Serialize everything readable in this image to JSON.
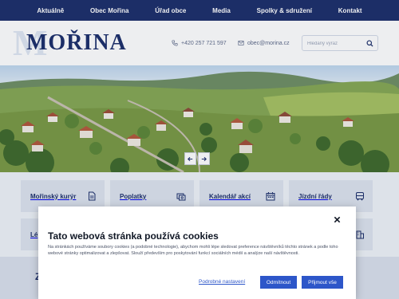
{
  "nav": {
    "items": [
      "Aktuálně",
      "Obec Mořina",
      "Úřad obce",
      "Media",
      "Spolky & sdružení",
      "Kontakt"
    ]
  },
  "header": {
    "watermark": "M",
    "logo": "MOŘINA",
    "phone": "+420 257 721 597",
    "email": "obec@morina.cz",
    "search_placeholder": "Hledaný výraz"
  },
  "tiles": [
    {
      "label": "Mořinský kurýr",
      "icon": "document-icon"
    },
    {
      "label": "Poplatky",
      "icon": "payment-icon"
    },
    {
      "label": "Kalendář akcí",
      "icon": "calendar-icon"
    },
    {
      "label": "Jízdní řády",
      "icon": "bus-icon"
    },
    {
      "label": "Lé",
      "icon": "none"
    },
    {
      "label": "",
      "icon": "building-icon"
    }
  ],
  "lower": {
    "partial_text": "Z"
  },
  "cookie": {
    "title": "Tato webová stránka používá cookies",
    "text": "Na stránkách používáme soubory cookies (a podobné technologie), abychom mohli lépe sledovat preference návštěvníků těchto stránek a podle toho webové stránky optimalizovat a zlepšovat. Slouží především pro poskytování funkcí sociálních médií a analýze naší návštěvnosti.",
    "settings_link": "Podrobné nastavení",
    "reject_label": "Odmítnout",
    "accept_label": "Přijmout vše"
  },
  "colors": {
    "navy": "#1d2f6b",
    "accent_blue": "#2d56c9",
    "tile_bg": "#dde3ee"
  }
}
